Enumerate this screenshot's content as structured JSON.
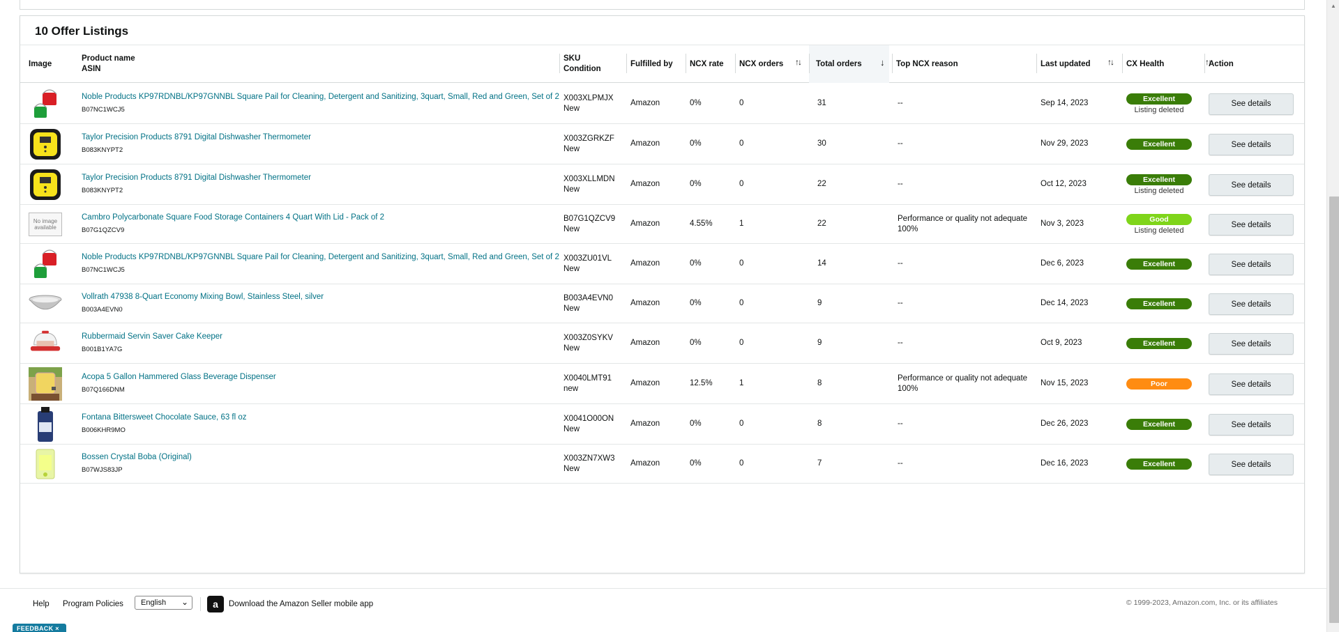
{
  "card": {
    "title": "10 Offer Listings"
  },
  "columns": {
    "image": "Image",
    "product_name": "Product name",
    "asin": "ASIN",
    "sku": "SKU",
    "condition": "Condition",
    "fulfilled_by": "Fulfilled by",
    "ncx_rate": "NCX rate",
    "ncx_orders": "NCX orders",
    "total_orders": "Total orders",
    "top_ncx_reason": "Top NCX reason",
    "last_updated": "Last updated",
    "cx_health": "CX Health",
    "action": "Action"
  },
  "colors": {
    "excellent": "#3a7d08",
    "good": "#7fd51a",
    "poor": "#ff8c12",
    "link": "#007185"
  },
  "rows": [
    {
      "name": "Noble Products KP97RDNBL/KP97GNNBL Square Pail for Cleaning, Detergent and Sanitizing, 3quart, Small, Red and Green, Set of 2",
      "asin": "B07NC1WCJ5",
      "sku": "X003XLPMJX",
      "condition": "New",
      "fulfilled": "Amazon",
      "ncx_rate": "0%",
      "ncx_orders": "0",
      "total_orders": "31",
      "reason": "--",
      "reason2": "",
      "updated": "Sep 14, 2023",
      "health": "Excellent",
      "health_color": "#3a7d08",
      "sub": "Listing deleted",
      "action": "See details",
      "img": "pails"
    },
    {
      "name": "Taylor Precision Products 8791 Digital Dishwasher Thermometer",
      "asin": "B083KNYPT2",
      "sku": "X003ZGRKZF",
      "condition": "New",
      "fulfilled": "Amazon",
      "ncx_rate": "0%",
      "ncx_orders": "0",
      "total_orders": "30",
      "reason": "--",
      "reason2": "",
      "updated": "Nov 29, 2023",
      "health": "Excellent",
      "health_color": "#3a7d08",
      "sub": "",
      "action": "See details",
      "img": "thermo"
    },
    {
      "name": "Taylor Precision Products 8791 Digital Dishwasher Thermometer",
      "asin": "B083KNYPT2",
      "sku": "X003XLLMDN",
      "condition": "New",
      "fulfilled": "Amazon",
      "ncx_rate": "0%",
      "ncx_orders": "0",
      "total_orders": "22",
      "reason": "--",
      "reason2": "",
      "updated": "Oct 12, 2023",
      "health": "Excellent",
      "health_color": "#3a7d08",
      "sub": "Listing deleted",
      "action": "See details",
      "img": "thermo"
    },
    {
      "name": "Cambro Polycarbonate Square Food Storage Containers 4 Quart With Lid - Pack of 2",
      "asin": "B07G1QZCV9",
      "sku": "B07G1QZCV9",
      "condition": "New",
      "fulfilled": "Amazon",
      "ncx_rate": "4.55%",
      "ncx_orders": "1",
      "total_orders": "22",
      "reason": "Performance or quality not adequate",
      "reason2": "100%",
      "updated": "Nov 3, 2023",
      "health": "Good",
      "health_color": "#7fd51a",
      "sub": "Listing deleted",
      "action": "See details",
      "img": "noimage",
      "noimage_text": "No image available"
    },
    {
      "name": "Noble Products KP97RDNBL/KP97GNNBL Square Pail for Cleaning, Detergent and Sanitizing, 3quart, Small, Red and Green, Set of 2",
      "asin": "B07NC1WCJ5",
      "sku": "X003ZU01VL",
      "condition": "New",
      "fulfilled": "Amazon",
      "ncx_rate": "0%",
      "ncx_orders": "0",
      "total_orders": "14",
      "reason": "--",
      "reason2": "",
      "updated": "Dec 6, 2023",
      "health": "Excellent",
      "health_color": "#3a7d08",
      "sub": "",
      "action": "See details",
      "img": "pails"
    },
    {
      "name": "Vollrath 47938 8-Quart Economy Mixing Bowl, Stainless Steel, silver",
      "asin": "B003A4EVN0",
      "sku": "B003A4EVN0",
      "condition": "New",
      "fulfilled": "Amazon",
      "ncx_rate": "0%",
      "ncx_orders": "0",
      "total_orders": "9",
      "reason": "--",
      "reason2": "",
      "updated": "Dec 14, 2023",
      "health": "Excellent",
      "health_color": "#3a7d08",
      "sub": "",
      "action": "See details",
      "img": "bowl"
    },
    {
      "name": "Rubbermaid Servin Saver Cake Keeper",
      "asin": "B001B1YA7G",
      "sku": "X003Z0SYKV",
      "condition": "New",
      "fulfilled": "Amazon",
      "ncx_rate": "0%",
      "ncx_orders": "0",
      "total_orders": "9",
      "reason": "--",
      "reason2": "",
      "updated": "Oct 9, 2023",
      "health": "Excellent",
      "health_color": "#3a7d08",
      "sub": "",
      "action": "See details",
      "img": "cake"
    },
    {
      "name": "Acopa 5 Gallon Hammered Glass Beverage Dispenser",
      "asin": "B07Q166DNM",
      "sku": "X0040LMT91",
      "condition": "new",
      "fulfilled": "Amazon",
      "ncx_rate": "12.5%",
      "ncx_orders": "1",
      "total_orders": "8",
      "reason": "Performance or quality not adequate",
      "reason2": "100%",
      "updated": "Nov 15, 2023",
      "health": "Poor",
      "health_color": "#ff8c12",
      "sub": "",
      "action": "See details",
      "img": "dispenser"
    },
    {
      "name": "Fontana Bittersweet Chocolate Sauce, 63 fl oz",
      "asin": "B006KHR9MO",
      "sku": "X0041O00ON",
      "condition": "New",
      "fulfilled": "Amazon",
      "ncx_rate": "0%",
      "ncx_orders": "0",
      "total_orders": "8",
      "reason": "--",
      "reason2": "",
      "updated": "Dec 26, 2023",
      "health": "Excellent",
      "health_color": "#3a7d08",
      "sub": "",
      "action": "See details",
      "img": "sauce"
    },
    {
      "name": "Bossen Crystal Boba (Original)",
      "asin": "B07WJS83JP",
      "sku": "X003ZN7XW3",
      "condition": "New",
      "fulfilled": "Amazon",
      "ncx_rate": "0%",
      "ncx_orders": "0",
      "total_orders": "7",
      "reason": "--",
      "reason2": "",
      "updated": "Dec 16, 2023",
      "health": "Excellent",
      "health_color": "#3a7d08",
      "sub": "",
      "action": "See details",
      "img": "boba"
    }
  ],
  "footer": {
    "help": "Help",
    "policies": "Program Policies",
    "language": "English",
    "app_text": "Download the Amazon Seller mobile app",
    "copyright": "© 1999-2023, Amazon.com, Inc. or its affiliates",
    "feedback": "FEEDBACK ×"
  }
}
